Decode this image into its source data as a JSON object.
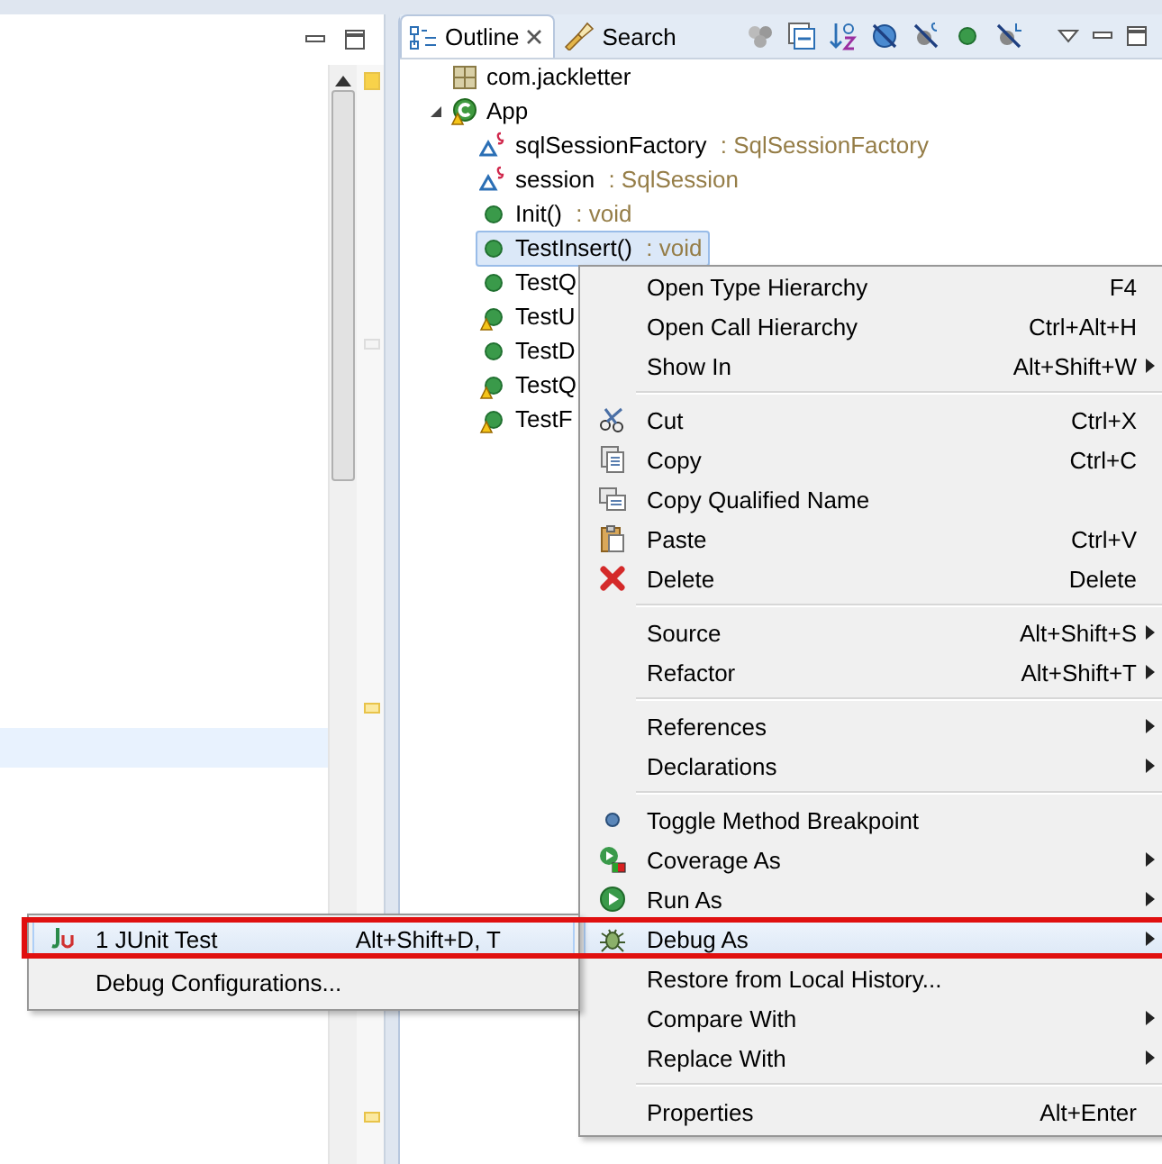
{
  "outline_view": {
    "tabs": [
      {
        "label": "Outline",
        "selected": true,
        "closable": true
      },
      {
        "label": "Search",
        "selected": false,
        "closable": false
      }
    ],
    "tree": [
      {
        "label": "com.jackletter",
        "kind": "package",
        "warning": false,
        "selected": false
      },
      {
        "label": "App",
        "kind": "class",
        "warning": true,
        "expanded": true,
        "selected": false,
        "children": [
          {
            "label": "sqlSessionFactory",
            "type": ": SqlSessionFactory",
            "kind": "field",
            "warning": false,
            "selected": false
          },
          {
            "label": "session",
            "type": ": SqlSession",
            "kind": "field",
            "warning": false,
            "selected": false
          },
          {
            "label": "Init()",
            "type": ": void",
            "kind": "method",
            "warning": false,
            "selected": false
          },
          {
            "label": "TestInsert()",
            "type": ": void",
            "kind": "method",
            "warning": false,
            "selected": true
          },
          {
            "label": "TestQ",
            "kind": "method",
            "warning": false,
            "selected": false
          },
          {
            "label": "TestU",
            "kind": "method",
            "warning": true,
            "selected": false
          },
          {
            "label": "TestD",
            "kind": "method",
            "warning": false,
            "selected": false
          },
          {
            "label": "TestQ",
            "kind": "method",
            "warning": true,
            "selected": false
          },
          {
            "label": "TestF",
            "kind": "method",
            "warning": true,
            "selected": false
          }
        ]
      }
    ]
  },
  "context_menu": {
    "items": [
      {
        "kind": "item",
        "label": "Open Type Hierarchy",
        "shortcut": "F4",
        "submenu": false,
        "highlighted": false
      },
      {
        "kind": "item",
        "label": "Open Call Hierarchy",
        "shortcut": "Ctrl+Alt+H",
        "submenu": false,
        "highlighted": false
      },
      {
        "kind": "item",
        "label": "Show In",
        "shortcut": "Alt+Shift+W",
        "submenu": true,
        "highlighted": false
      },
      {
        "kind": "separator"
      },
      {
        "kind": "item",
        "label": "Cut",
        "shortcut": "Ctrl+X",
        "submenu": false,
        "highlighted": false
      },
      {
        "kind": "item",
        "label": "Copy",
        "shortcut": "Ctrl+C",
        "submenu": false,
        "highlighted": false
      },
      {
        "kind": "item",
        "label": "Copy Qualified Name",
        "submenu": false,
        "highlighted": false
      },
      {
        "kind": "item",
        "label": "Paste",
        "shortcut": "Ctrl+V",
        "submenu": false,
        "highlighted": false
      },
      {
        "kind": "item",
        "label": "Delete",
        "shortcut": "Delete",
        "submenu": false,
        "highlighted": false
      },
      {
        "kind": "separator"
      },
      {
        "kind": "item",
        "label": "Source",
        "shortcut": "Alt+Shift+S",
        "submenu": true,
        "highlighted": false
      },
      {
        "kind": "item",
        "label": "Refactor",
        "shortcut": "Alt+Shift+T",
        "submenu": true,
        "highlighted": false
      },
      {
        "kind": "separator"
      },
      {
        "kind": "item",
        "label": "References",
        "submenu": true,
        "highlighted": false
      },
      {
        "kind": "item",
        "label": "Declarations",
        "submenu": true,
        "highlighted": false
      },
      {
        "kind": "separator"
      },
      {
        "kind": "item",
        "label": "Toggle Method Breakpoint",
        "submenu": false,
        "highlighted": false
      },
      {
        "kind": "item",
        "label": "Coverage As",
        "submenu": true,
        "highlighted": false
      },
      {
        "kind": "item",
        "label": "Run As",
        "submenu": true,
        "highlighted": false
      },
      {
        "kind": "item",
        "label": "Debug As",
        "submenu": true,
        "highlighted": true
      },
      {
        "kind": "item",
        "label": "Restore from Local History...",
        "submenu": false,
        "highlighted": false
      },
      {
        "kind": "item",
        "label": "Compare With",
        "submenu": true,
        "highlighted": false
      },
      {
        "kind": "item",
        "label": "Replace With",
        "submenu": true,
        "highlighted": false
      },
      {
        "kind": "separator"
      },
      {
        "kind": "item",
        "label": "Properties",
        "shortcut": "Alt+Enter",
        "submenu": false,
        "highlighted": false
      }
    ]
  },
  "submenu": {
    "items": [
      {
        "kind": "item",
        "label": "1 JUnit Test",
        "shortcut": "Alt+Shift+D, T",
        "highlighted": true
      },
      {
        "kind": "item",
        "label": "Debug Configurations...",
        "highlighted": false
      }
    ]
  },
  "annotation": {
    "kind": "highlight-frame"
  }
}
